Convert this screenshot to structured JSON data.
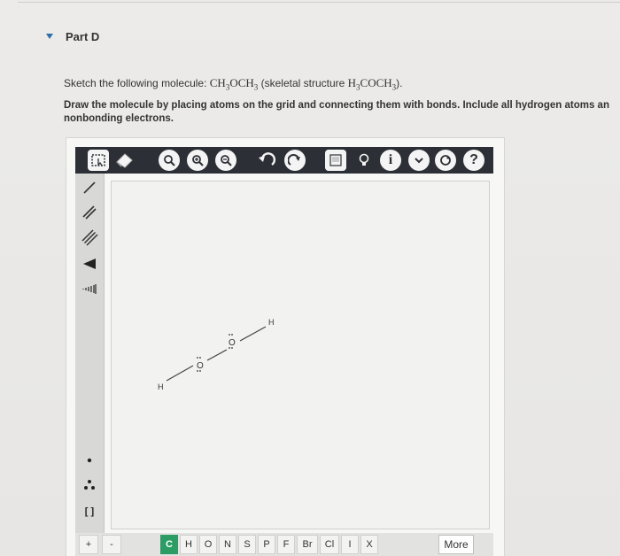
{
  "part": {
    "title": "Part D"
  },
  "question": {
    "prompt_prefix": "Sketch the following molecule: ",
    "formula_main": "CH3OCH3",
    "skeletal_prefix": " (skeletal structure ",
    "formula_skeletal": "H3COCH3",
    "skeletal_suffix": ").",
    "instructions_line1": "Draw the molecule by placing atoms on the grid and connecting them with bonds. Include all hydrogen atoms an",
    "instructions_line2": "nonbonding electrons."
  },
  "toolbar": {
    "icons": [
      "select-icon",
      "eraser-icon",
      "zoom-icon",
      "zoom-in-icon",
      "zoom-out-icon",
      "undo-icon",
      "redo-icon",
      "templates-icon",
      "lightbulb-icon",
      "info-icon",
      "chevron-down-icon",
      "reset-icon",
      "help-icon"
    ],
    "info_label": "i",
    "help_label": "?"
  },
  "left_tools": [
    "single-bond-icon",
    "double-bond-icon",
    "triple-bond-icon",
    "wedge-bond-icon",
    "hash-bond-icon",
    "radical-icon",
    "lone-pair-icon",
    "bracket-icon"
  ],
  "left_tools_text": {
    "bracket": "[ ]"
  },
  "canvas": {
    "atoms": [
      {
        "label": "H"
      },
      {
        "label": "O"
      },
      {
        "label": "O"
      },
      {
        "label": "H"
      }
    ]
  },
  "bottom_bar": {
    "charge_plus": "+",
    "charge_minus": "-",
    "elements": [
      "C",
      "H",
      "O",
      "N",
      "S",
      "P",
      "F",
      "Br",
      "Cl",
      "I",
      "X"
    ],
    "selected_element": "C",
    "more_label": "More"
  },
  "colors": {
    "toolbar_bg": "#2c3036",
    "selected_element": "#2a9c64",
    "part_caret": "#2d6fa8"
  }
}
